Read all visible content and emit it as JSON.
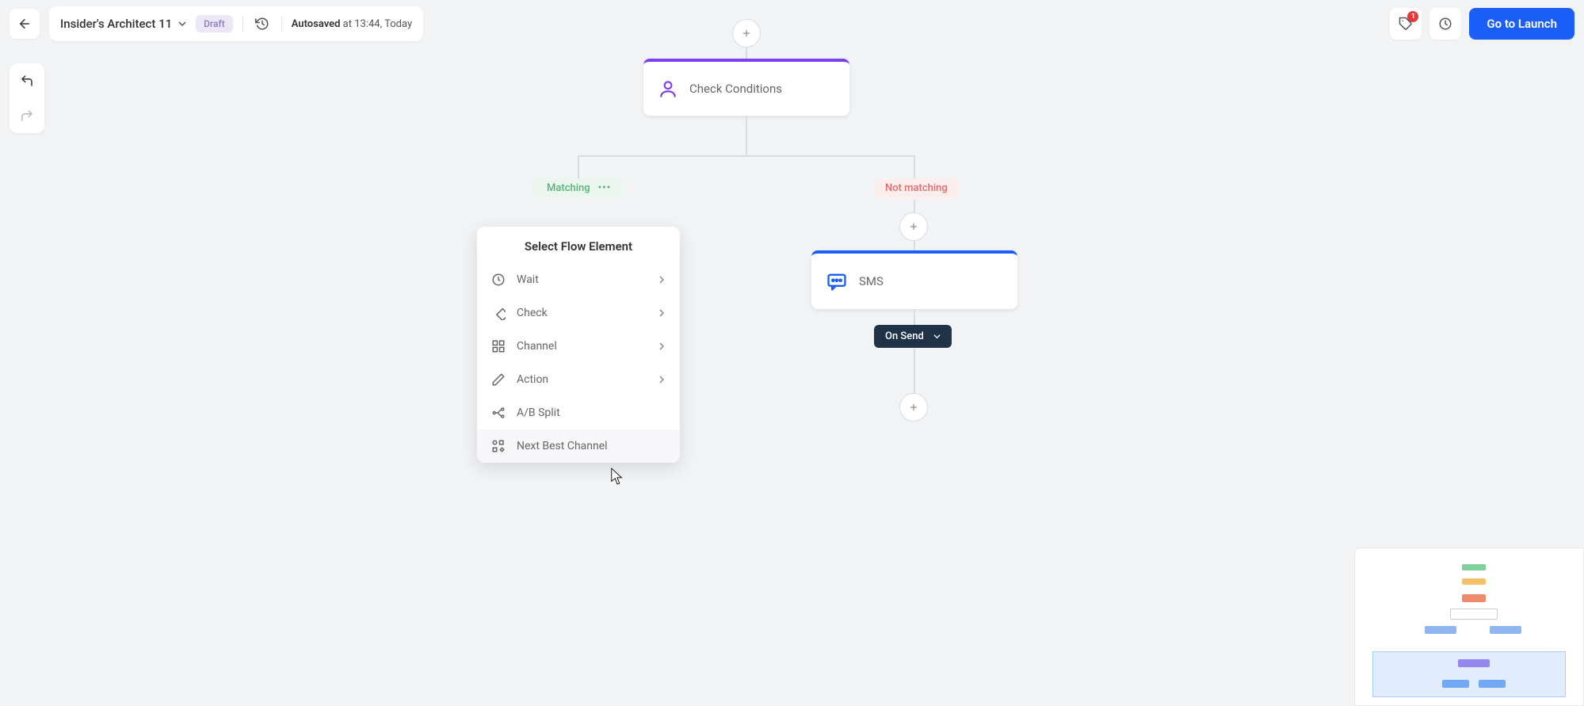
{
  "header": {
    "project_name": "Insider's Architect 11",
    "status_pill": "Draft",
    "autosave_prefix": "Autosaved",
    "autosave_rest": " at 13:44, Today",
    "launch_label": "Go to Launch",
    "notif_count": "1"
  },
  "nodes": {
    "check_conditions": "Check Conditions",
    "sms": "SMS",
    "matching": "Matching",
    "not_matching": "Not matching",
    "on_send": "On Send"
  },
  "popover": {
    "title": "Select Flow Element",
    "items": [
      {
        "label": "Wait",
        "has_children": true
      },
      {
        "label": "Check",
        "has_children": true
      },
      {
        "label": "Channel",
        "has_children": true
      },
      {
        "label": "Action",
        "has_children": true
      },
      {
        "label": "A/B Split",
        "has_children": false
      },
      {
        "label": "Next Best Channel",
        "has_children": false
      }
    ]
  }
}
